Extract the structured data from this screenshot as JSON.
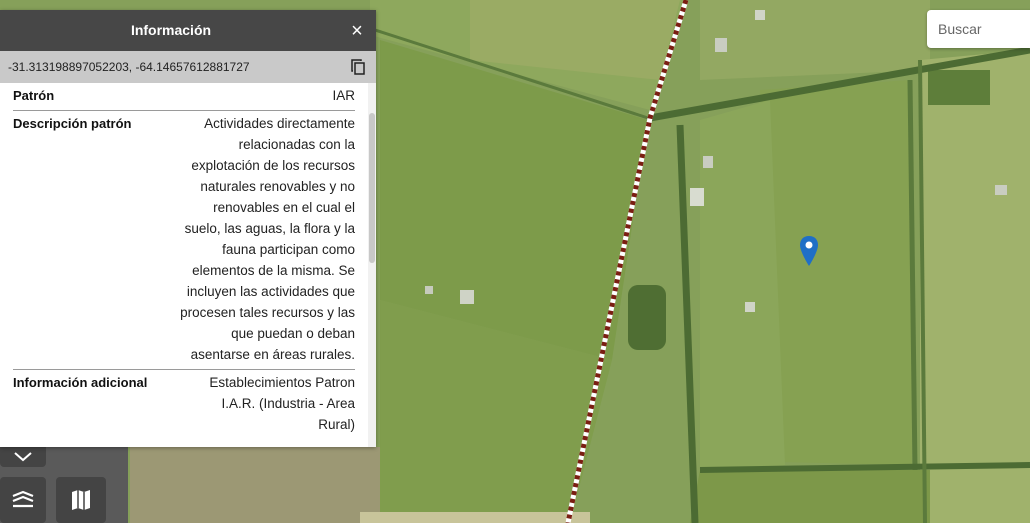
{
  "panel": {
    "title": "Información",
    "close_label": "×",
    "coordinates": "-31.313198897052203, -64.14657612881727",
    "rows": [
      {
        "label": "Patrón",
        "value": "IAR"
      },
      {
        "label": "Descripción patrón",
        "value": "Actividades directamente relacionadas con la explotación de los recursos naturales renovables y no renovables en el cual el suelo, las aguas, la flora y la fauna participan como elementos de la misma. Se incluyen las actividades que procesen tales recursos y las que puedan o deban asentarse en áreas rurales."
      },
      {
        "label": "Información adicional",
        "value": "Establecimientos Patron I.A.R. (Industria - Area Rural)"
      }
    ]
  },
  "search": {
    "placeholder": "Buscar"
  },
  "icons": {
    "close": "close-icon",
    "copy": "copy-icon",
    "layers": "layers-icon",
    "map": "map-icon",
    "location_marker": "location-marker-icon",
    "collapse": "chevron-down-icon"
  },
  "colors": {
    "panel_header": "#474747",
    "coords_bar": "#c9c9c9",
    "marker": "#1f6fc6",
    "boundary_line": "#7a1e12"
  }
}
